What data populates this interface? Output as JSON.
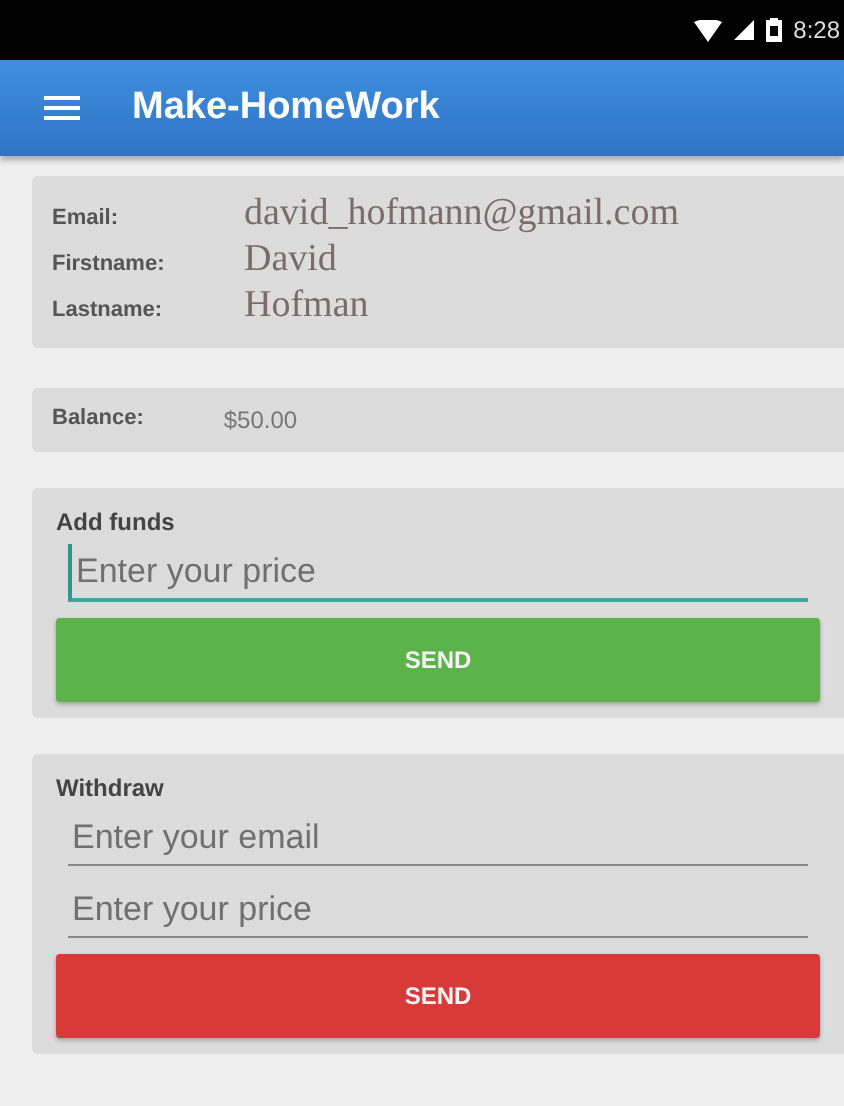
{
  "status_bar": {
    "time": "8:28"
  },
  "app_bar": {
    "title": "Make-HomeWork"
  },
  "profile": [
    {
      "label": "Email:",
      "value": "david_hofmann@gmail.com"
    },
    {
      "label": "Firstname:",
      "value": "David"
    },
    {
      "label": "Lastname:",
      "value": "Hofman"
    }
  ],
  "balance": {
    "label": "Balance:",
    "value": "$50.00"
  },
  "forms": [
    {
      "title": "Add funds",
      "fields": [
        {
          "placeholder": "Enter your price",
          "focused": true
        }
      ],
      "button": {
        "label": "SEND",
        "color": "#5cb34a"
      }
    },
    {
      "title": "Withdraw",
      "fields": [
        {
          "placeholder": "Enter your email",
          "focused": false
        },
        {
          "placeholder": "Enter your price",
          "focused": false
        }
      ],
      "button": {
        "label": "SEND",
        "color": "#d83a3a"
      }
    }
  ]
}
